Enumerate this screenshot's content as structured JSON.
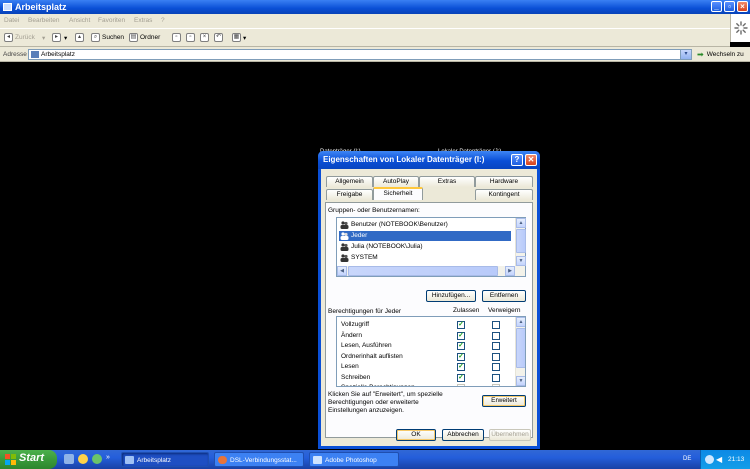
{
  "window": {
    "title": "Arbeitsplatz"
  },
  "menu": [
    "Datei",
    "Bearbeiten",
    "Ansicht",
    "Favoriten",
    "Extras",
    "?"
  ],
  "toolbar": {
    "back": "Zurück",
    "search": "Suchen",
    "folders": "Ordner"
  },
  "address": {
    "label": "Adresse",
    "value": "Arbeitsplatz",
    "go": "Wechseln zu"
  },
  "background": {
    "drive_left": "Datenträger (I:)",
    "drive_right": "Lokaler Datenträger (J:)"
  },
  "dialog": {
    "title": "Eigenschaften von Lokaler Datenträger (I:)",
    "help": "?",
    "close": "✕",
    "tabs_row1": [
      "Allgemein",
      "AutoPlay",
      "Extras",
      "Hardware"
    ],
    "tabs_row2": [
      "Freigabe",
      "Sicherheit",
      "Kontingent"
    ],
    "groups_label": "Gruppen- oder Benutzernamen:",
    "users": [
      {
        "name": "Benutzer (NOTEBOOK\\Benutzer)",
        "selected": false
      },
      {
        "name": "Jeder",
        "selected": true
      },
      {
        "name": "Julia (NOTEBOOK\\Julia)",
        "selected": false
      },
      {
        "name": "SYSTEM",
        "selected": false
      }
    ],
    "add_button": "Hinzufügen...",
    "remove_button": "Entfernen",
    "permissions_label": "Berechtigungen für Jeder",
    "allow_header": "Zulassen",
    "deny_header": "Verweigern",
    "permissions": [
      {
        "name": "Vollzugriff",
        "allow": true,
        "deny": false
      },
      {
        "name": "Ändern",
        "allow": true,
        "deny": false
      },
      {
        "name": "Lesen, Ausführen",
        "allow": true,
        "deny": false
      },
      {
        "name": "Ordnerinhalt auflisten",
        "allow": true,
        "deny": false
      },
      {
        "name": "Lesen",
        "allow": true,
        "deny": false
      },
      {
        "name": "Schreiben",
        "allow": true,
        "deny": false
      },
      {
        "name": "Spezielle Berechtigungen",
        "allow": false,
        "deny": false
      }
    ],
    "advanced_text": "Klicken Sie auf \"Erweitert\", um spezielle Berechtigungen oder erweiterte Einstellungen anzuzeigen.",
    "advanced_button": "Erweitert",
    "ok_button": "OK",
    "cancel_button": "Abbrechen",
    "apply_button": "Übernehmen"
  },
  "taskbar": {
    "start": "Start",
    "tasks": [
      {
        "label": "Arbeitsplatz",
        "active": true
      },
      {
        "label": "DSL-Verbindungsstat...",
        "active": false
      },
      {
        "label": "Adobe Photoshop",
        "active": false
      }
    ],
    "language": "DE",
    "clock": "21:13"
  },
  "colors": {
    "titlebar": "#0a4fd6",
    "selection": "#316ac5",
    "taskbar": "#245edb",
    "start": "#3a9a3a"
  }
}
